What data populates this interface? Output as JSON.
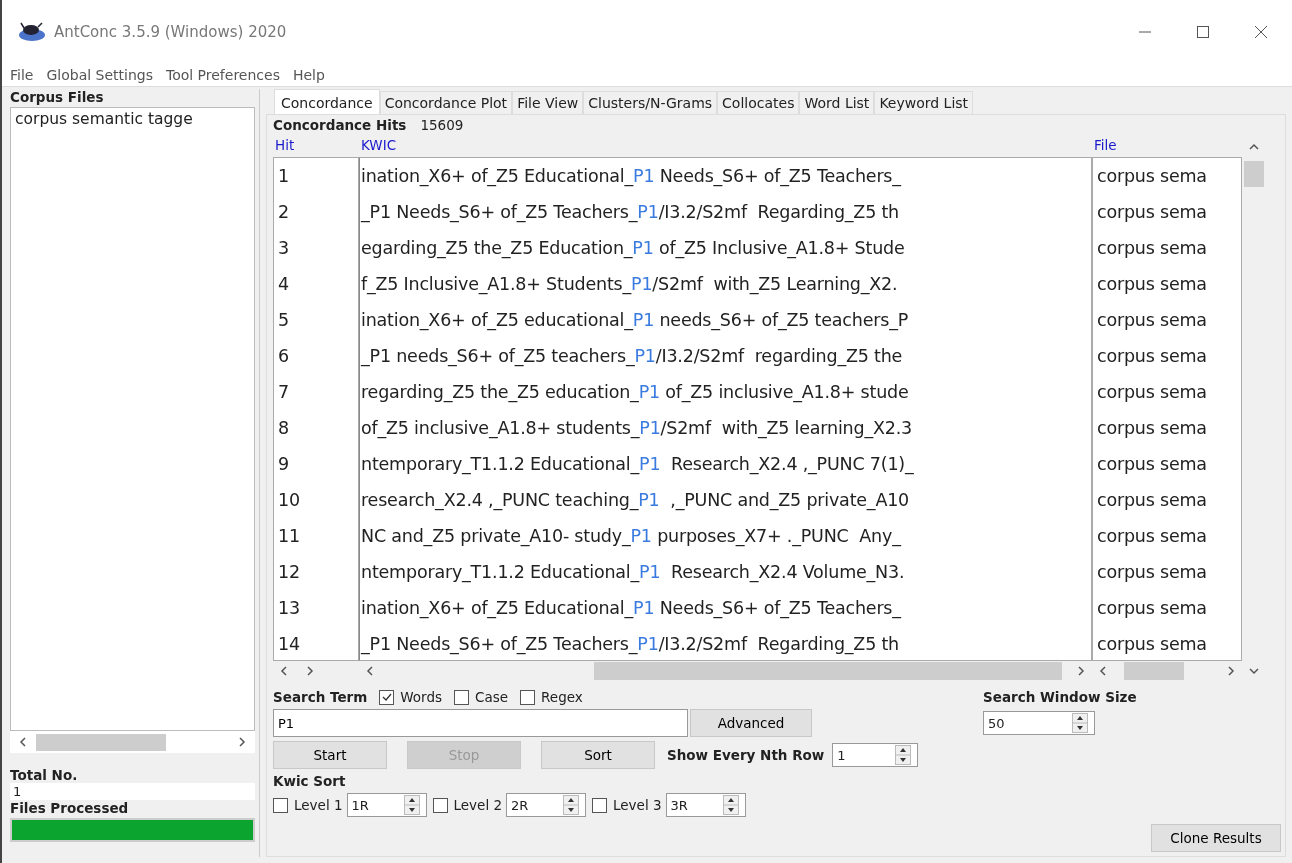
{
  "window": {
    "title": "AntConc 3.5.9 (Windows) 2020"
  },
  "menu": [
    "File",
    "Global Settings",
    "Tool Preferences",
    "Help"
  ],
  "corpus_files": {
    "label": "Corpus Files",
    "items": [
      "corpus semantic tagge"
    ]
  },
  "total": {
    "label": "Total No.",
    "value": "1"
  },
  "files_processed": {
    "label": "Files Processed",
    "level": 1
  },
  "tabs": [
    {
      "label": "Concordance",
      "selected": true
    },
    {
      "label": "Concordance Plot",
      "selected": false
    },
    {
      "label": "File View",
      "selected": false
    },
    {
      "label": "Clusters/N-Grams",
      "selected": false
    },
    {
      "label": "Collocates",
      "selected": false
    },
    {
      "label": "Word List",
      "selected": false
    },
    {
      "label": "Keyword List",
      "selected": false
    }
  ],
  "hits": {
    "label": "Concordance Hits",
    "count": "15609"
  },
  "table": {
    "columns": [
      "Hit",
      "KWIC",
      "File"
    ],
    "rows": [
      {
        "hit": "1",
        "left": "ination_X6+ of_Z5 Educational_",
        "keyword": "P1",
        "right": " Needs_S6+ of_Z5 Teachers_",
        "file": "corpus sema"
      },
      {
        "hit": "2",
        "left": "_P1 Needs_S6+ of_Z5 Teachers_",
        "keyword": "P1",
        "right": "/I3.2/S2mf  Regarding_Z5 th",
        "file": "corpus sema"
      },
      {
        "hit": "3",
        "left": "egarding_Z5 the_Z5 Education_",
        "keyword": "P1",
        "right": " of_Z5 Inclusive_A1.8+ Stude",
        "file": "corpus sema"
      },
      {
        "hit": "4",
        "left": "f_Z5 Inclusive_A1.8+ Students_",
        "keyword": "P1",
        "right": "/S2mf  with_Z5 Learning_X2.",
        "file": "corpus sema"
      },
      {
        "hit": "5",
        "left": "ination_X6+ of_Z5 educational_",
        "keyword": "P1",
        "right": " needs_S6+ of_Z5 teachers_P",
        "file": "corpus sema"
      },
      {
        "hit": "6",
        "left": "_P1 needs_S6+ of_Z5 teachers_",
        "keyword": "P1",
        "right": "/I3.2/S2mf  regarding_Z5 the",
        "file": "corpus sema"
      },
      {
        "hit": "7",
        "left": "regarding_Z5 the_Z5 education_",
        "keyword": "P1",
        "right": " of_Z5 inclusive_A1.8+ stude",
        "file": "corpus sema"
      },
      {
        "hit": "8",
        "left": "of_Z5 inclusive_A1.8+ students_",
        "keyword": "P1",
        "right": "/S2mf  with_Z5 learning_X2.3",
        "file": "corpus sema"
      },
      {
        "hit": "9",
        "left": "ntemporary_T1.1.2 Educational_",
        "keyword": "P1",
        "right": "  Research_X2.4 ,_PUNC 7(1)_",
        "file": "corpus sema"
      },
      {
        "hit": "10",
        "left": "research_X2.4 ,_PUNC teaching_",
        "keyword": "P1",
        "right": "  ,_PUNC and_Z5 private_A10",
        "file": "corpus sema"
      },
      {
        "hit": "11",
        "left": "NC and_Z5 private_A10- study_",
        "keyword": "P1",
        "right": " purposes_X7+ ._PUNC  Any_",
        "file": "corpus sema"
      },
      {
        "hit": "12",
        "left": "ntemporary_T1.1.2 Educational_",
        "keyword": "P1",
        "right": "  Research_X2.4 Volume_N3.",
        "file": "corpus sema"
      },
      {
        "hit": "13",
        "left": "ination_X6+ of_Z5 Educational_",
        "keyword": "P1",
        "right": " Needs_S6+ of_Z5 Teachers_",
        "file": "corpus sema"
      },
      {
        "hit": "14",
        "left": "_P1 Needs_S6+ of_Z5 Teachers_",
        "keyword": "P1",
        "right": "/I3.2/S2mf  Regarding_Z5 th",
        "file": "corpus sema"
      }
    ]
  },
  "search": {
    "label": "Search Term",
    "options": [
      {
        "label": "Words",
        "checked": true
      },
      {
        "label": "Case",
        "checked": false
      },
      {
        "label": "Regex",
        "checked": false
      }
    ],
    "value": "P1",
    "advanced": "Advanced"
  },
  "buttons": [
    {
      "label": "Start",
      "disabled": false
    },
    {
      "label": "Stop",
      "disabled": true
    },
    {
      "label": "Sort",
      "disabled": false
    }
  ],
  "nth_row": {
    "label": "Show Every Nth Row",
    "value": "1"
  },
  "window_size": {
    "label": "Search Window Size",
    "value": "50"
  },
  "kwic_sort": {
    "label": "Kwic Sort",
    "levels": [
      {
        "label": "Level 1",
        "checked": false,
        "value": "1R"
      },
      {
        "label": "Level 2",
        "checked": false,
        "value": "2R"
      },
      {
        "label": "Level 3",
        "checked": false,
        "value": "3R"
      }
    ]
  },
  "clone": "Clone Results"
}
